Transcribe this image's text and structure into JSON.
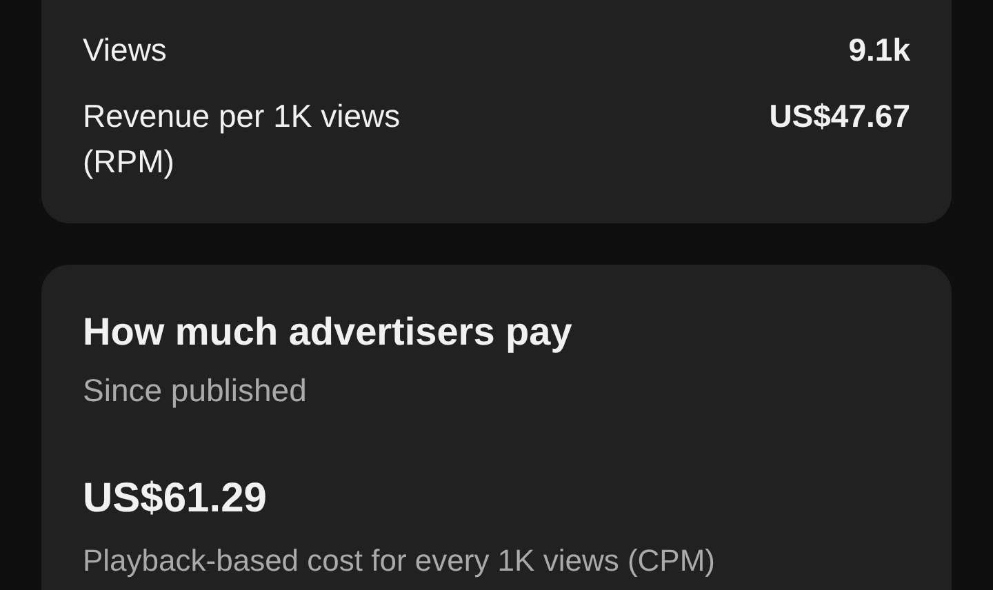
{
  "revenue_card": {
    "rows": [
      {
        "label": "Views",
        "value": "9.1k"
      },
      {
        "label": "Revenue per 1K views (RPM)",
        "value": "US$47.67"
      }
    ]
  },
  "advertisers_card": {
    "title": "How much advertisers pay",
    "subtitle": "Since published",
    "amount": "US$61.29",
    "caption": "Playback-based cost for every 1K views (CPM)"
  }
}
